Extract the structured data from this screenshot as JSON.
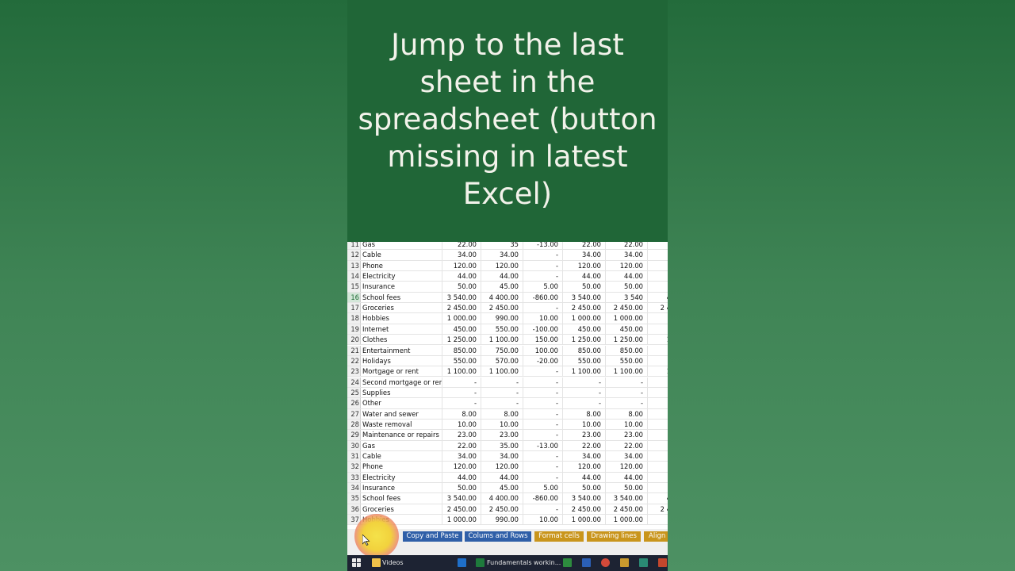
{
  "overlay": {
    "title": "Jump to the last\nsheet in the\nspreadsheet (button\nmissing in latest\nExcel)"
  },
  "sheet": {
    "rows": [
      {
        "n": "11",
        "label": "Gas",
        "v": [
          "22.00",
          "35",
          "-13.00",
          "22.00",
          "22.00",
          ""
        ]
      },
      {
        "n": "12",
        "label": "Cable",
        "v": [
          "34.00",
          "34.00",
          "-",
          "34.00",
          "34.00",
          ""
        ]
      },
      {
        "n": "13",
        "label": "Phone",
        "v": [
          "120.00",
          "120.00",
          "-",
          "120.00",
          "120.00",
          ""
        ]
      },
      {
        "n": "14",
        "label": "Electricity",
        "v": [
          "44.00",
          "44.00",
          "-",
          "44.00",
          "44.00",
          ""
        ]
      },
      {
        "n": "15",
        "label": "Insurance",
        "v": [
          "50.00",
          "45.00",
          "5.00",
          "50.00",
          "50.00",
          ""
        ]
      },
      {
        "n": "16",
        "label": "School fees",
        "v": [
          "3 540.00",
          "4 400.00",
          "-860.00",
          "3 540.00",
          "3 540",
          "4"
        ]
      },
      {
        "n": "17",
        "label": "Groceries",
        "v": [
          "2 450.00",
          "2 450.00",
          "-",
          "2 450.00",
          "2 450.00",
          "2 4"
        ]
      },
      {
        "n": "18",
        "label": "Hobbies",
        "v": [
          "1 000.00",
          "990.00",
          "10.00",
          "1 000.00",
          "1 000.00",
          ""
        ]
      },
      {
        "n": "19",
        "label": "Internet",
        "v": [
          "450.00",
          "550.00",
          "-100.00",
          "450.00",
          "450.00",
          ""
        ]
      },
      {
        "n": "20",
        "label": "Clothes",
        "v": [
          "1 250.00",
          "1 100.00",
          "150.00",
          "1 250.00",
          "1 250.00",
          "1"
        ]
      },
      {
        "n": "21",
        "label": "Entertainment",
        "v": [
          "850.00",
          "750.00",
          "100.00",
          "850.00",
          "850.00",
          ""
        ]
      },
      {
        "n": "22",
        "label": "Holidays",
        "v": [
          "550.00",
          "570.00",
          "-20.00",
          "550.00",
          "550.00",
          ""
        ]
      },
      {
        "n": "23",
        "label": "Mortgage or rent",
        "v": [
          "1 100.00",
          "1 100.00",
          "-",
          "1 100.00",
          "1 100.00",
          "1"
        ]
      },
      {
        "n": "24",
        "label": "Second mortgage or rent",
        "v": [
          "-",
          "-",
          "-",
          "-",
          "-",
          ""
        ]
      },
      {
        "n": "25",
        "label": "Supplies",
        "v": [
          "-",
          "-",
          "-",
          "-",
          "-",
          ""
        ]
      },
      {
        "n": "26",
        "label": "Other",
        "v": [
          "-",
          "-",
          "-",
          "-",
          "-",
          ""
        ]
      },
      {
        "n": "27",
        "label": "Water and sewer",
        "v": [
          "8.00",
          "8.00",
          "-",
          "8.00",
          "8.00",
          ""
        ]
      },
      {
        "n": "28",
        "label": "Waste removal",
        "v": [
          "10.00",
          "10.00",
          "-",
          "10.00",
          "10.00",
          ""
        ]
      },
      {
        "n": "29",
        "label": "Maintenance or repairs",
        "v": [
          "23.00",
          "23.00",
          "-",
          "23.00",
          "23.00",
          ""
        ]
      },
      {
        "n": "30",
        "label": "Gas",
        "v": [
          "22.00",
          "35.00",
          "-13.00",
          "22.00",
          "22.00",
          ""
        ]
      },
      {
        "n": "31",
        "label": "Cable",
        "v": [
          "34.00",
          "34.00",
          "-",
          "34.00",
          "34.00",
          ""
        ]
      },
      {
        "n": "32",
        "label": "Phone",
        "v": [
          "120.00",
          "120.00",
          "-",
          "120.00",
          "120.00",
          ""
        ]
      },
      {
        "n": "33",
        "label": "Electricity",
        "v": [
          "44.00",
          "44.00",
          "-",
          "44.00",
          "44.00",
          ""
        ]
      },
      {
        "n": "34",
        "label": "Insurance",
        "v": [
          "50.00",
          "45.00",
          "5.00",
          "50.00",
          "50.00",
          ""
        ]
      },
      {
        "n": "35",
        "label": "School fees",
        "v": [
          "3 540.00",
          "4 400.00",
          "-860.00",
          "3 540.00",
          "3 540.00",
          "4"
        ]
      },
      {
        "n": "36",
        "label": "Groceries",
        "v": [
          "2 450.00",
          "2 450.00",
          "-",
          "2 450.00",
          "2 450.00",
          "2 4"
        ]
      },
      {
        "n": "37",
        "label": "Hobbies",
        "v": [
          "1 000.00",
          "990.00",
          "10.00",
          "1 000.00",
          "1 000.00",
          ""
        ]
      }
    ],
    "selected_row": "16"
  },
  "tabs": {
    "overflow_label": "...",
    "items": [
      {
        "label": "Copy and Paste",
        "color": "blue"
      },
      {
        "label": "Colums and Rows",
        "color": "blue"
      },
      {
        "label": "Format cells",
        "color": "gold"
      },
      {
        "label": "Drawing lines",
        "color": "gold"
      },
      {
        "label": "Align",
        "color": "gold"
      }
    ]
  },
  "taskbar": {
    "folder_label": "Videos",
    "excel_window_label": "Fundamentals workin..."
  },
  "colors": {
    "background_green": "#3f8455",
    "title_panel": "#206637",
    "tab_blue": "#2f5fa8",
    "tab_gold": "#c9951c"
  }
}
